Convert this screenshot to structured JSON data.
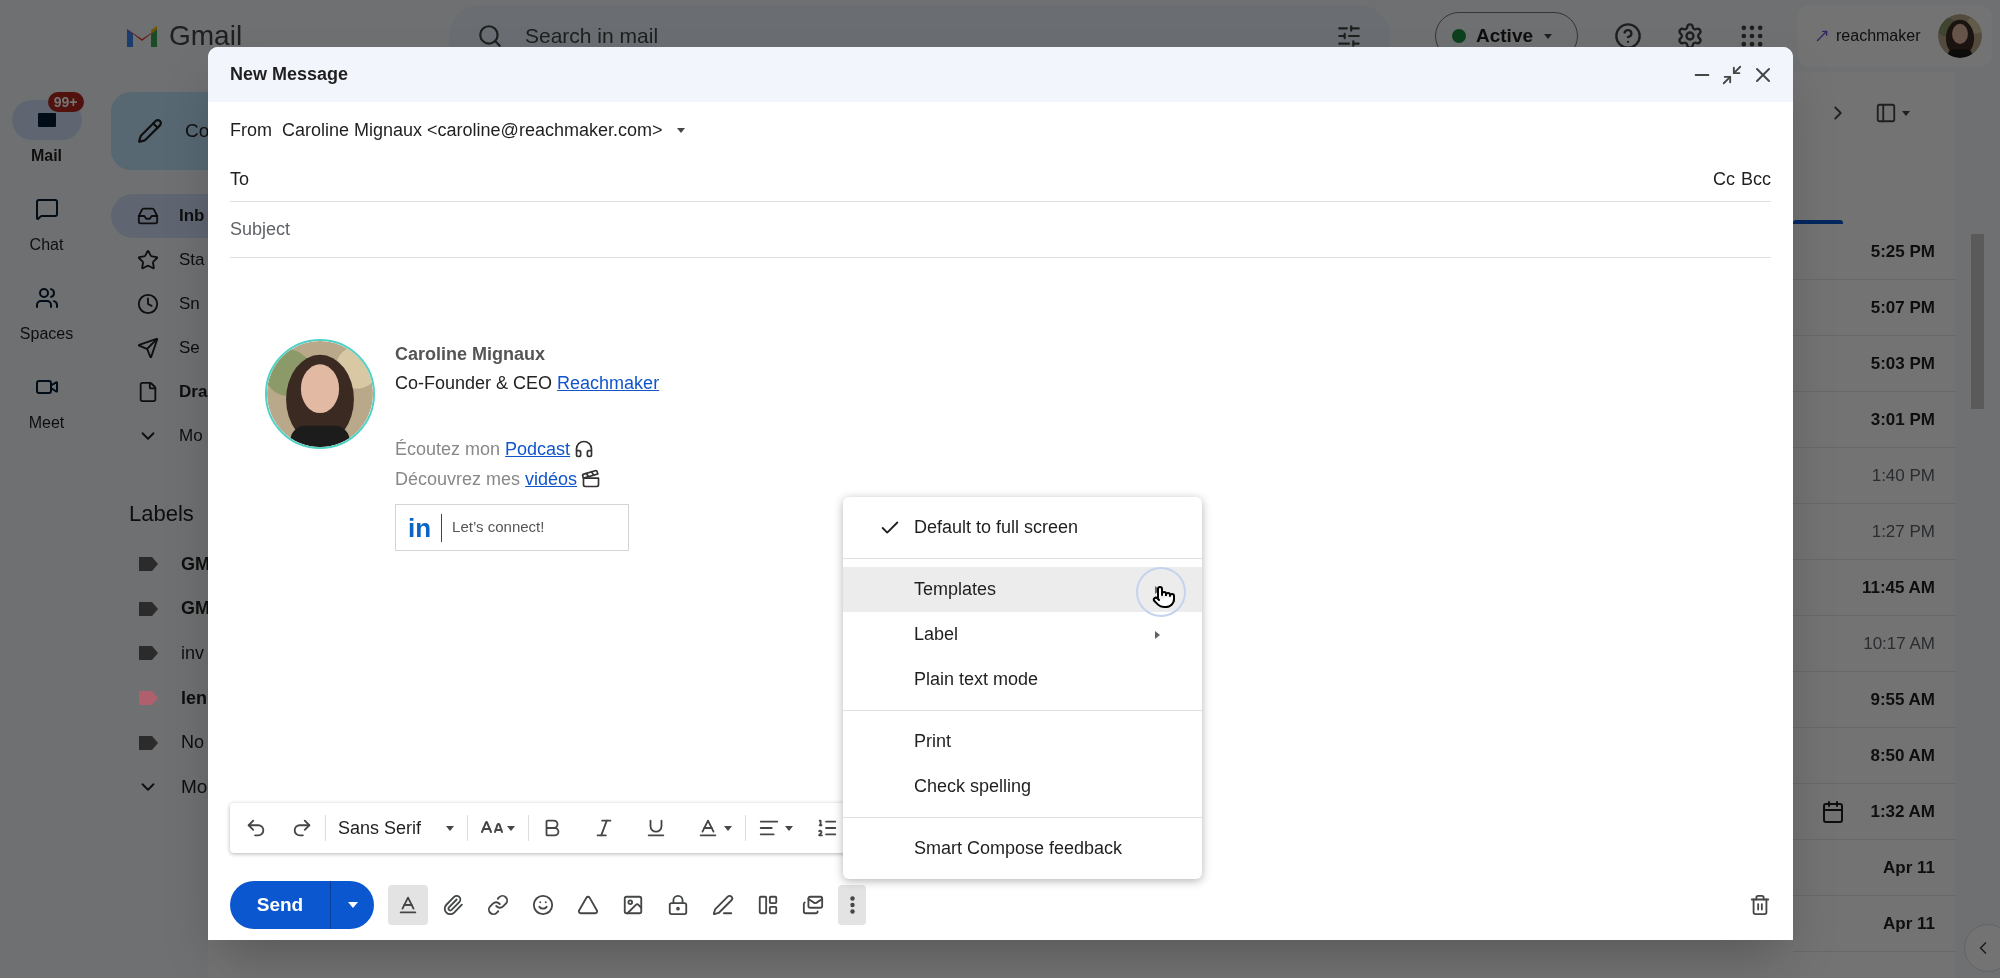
{
  "topbar": {
    "logo_text": "Gmail",
    "search": {
      "placeholder": "Search in mail"
    },
    "status": {
      "label": "Active"
    },
    "account": {
      "name": "reachmaker"
    }
  },
  "rail": [
    {
      "label": "Mail",
      "kind": "mail",
      "selected": true,
      "badge": "99+"
    },
    {
      "label": "Chat",
      "kind": "chat",
      "selected": false
    },
    {
      "label": "Spaces",
      "kind": "spaces",
      "selected": false
    },
    {
      "label": "Meet",
      "kind": "meet",
      "selected": false
    }
  ],
  "nav": {
    "compose": "Co",
    "items": [
      {
        "label": "Inb",
        "kind": "inbox",
        "selected": true,
        "has_unread": true
      },
      {
        "label": "Sta",
        "kind": "starred",
        "selected": false,
        "has_unread": false
      },
      {
        "label": "Sn",
        "kind": "snoozed",
        "selected": false,
        "has_unread": false
      },
      {
        "label": "Se",
        "kind": "sent",
        "selected": false,
        "has_unread": false
      },
      {
        "label": "Dra",
        "kind": "drafts",
        "selected": false,
        "has_unread": true
      },
      {
        "label": "Mo",
        "kind": "more",
        "selected": false,
        "has_unread": false
      }
    ],
    "labels_heading": "Labels",
    "labels": [
      {
        "label": "GM",
        "color": "#2b2b2b",
        "has_unread": true
      },
      {
        "label": "GM",
        "color": "#2b2b2b",
        "has_unread": true
      },
      {
        "label": "inv",
        "color": "#2b2b2b",
        "has_unread": false
      },
      {
        "label": "len",
        "color": "#b0606c",
        "has_unread": true
      },
      {
        "label": "No",
        "color": "#2b2b2b",
        "has_unread": false
      }
    ],
    "labels_more": "Mo"
  },
  "mail_list": [
    {
      "time": "5:25 PM",
      "unread": true,
      "calendar": false
    },
    {
      "time": "5:07 PM",
      "unread": true,
      "calendar": false
    },
    {
      "time": "5:03 PM",
      "unread": true,
      "calendar": false
    },
    {
      "time": "3:01 PM",
      "unread": true,
      "calendar": false
    },
    {
      "time": "1:40 PM",
      "unread": false,
      "calendar": false
    },
    {
      "time": "1:27 PM",
      "unread": false,
      "calendar": false
    },
    {
      "time": "11:45 AM",
      "unread": true,
      "calendar": false
    },
    {
      "time": "10:17 AM",
      "unread": false,
      "calendar": false
    },
    {
      "time": "9:55 AM",
      "unread": true,
      "calendar": false
    },
    {
      "time": "8:50 AM",
      "unread": true,
      "calendar": false
    },
    {
      "time": "1:32 AM",
      "unread": true,
      "calendar": true
    },
    {
      "time": "Apr 11",
      "unread": true,
      "calendar": false
    },
    {
      "time": "Apr 11",
      "unread": true,
      "calendar": false
    }
  ],
  "compose": {
    "title": "New Message",
    "from_label": "From",
    "from": "Caroline Mignaux <caroline@reachmaker.com>",
    "to_label": "To",
    "cc": "Cc",
    "bcc": "Bcc",
    "subject_placeholder": "Subject",
    "signature": {
      "name": "Caroline Mignaux",
      "role": "Co-Founder & CEO",
      "company_link": "Reachmaker",
      "podcast_text": "Écoutez mon",
      "podcast_link": "Podcast",
      "videos_text": "Découvrez mes",
      "videos_link": "vidéos",
      "linkedin_logo": "in",
      "linkedin_label": "Let’s connect!"
    },
    "font": "Sans Serif",
    "send": "Send",
    "formatting_on": true,
    "more_active": true
  },
  "menu": {
    "sections": [
      [
        {
          "label": "Default to full screen",
          "checked": true,
          "submenu": false,
          "highlighted": false
        }
      ],
      [
        {
          "label": "Templates",
          "checked": false,
          "submenu": true,
          "highlighted": true
        },
        {
          "label": "Label",
          "checked": false,
          "submenu": true,
          "highlighted": false
        },
        {
          "label": "Plain text mode",
          "checked": false,
          "submenu": false,
          "highlighted": false
        }
      ],
      [
        {
          "label": "Print",
          "checked": false,
          "submenu": false,
          "highlighted": false
        },
        {
          "label": "Check spelling",
          "checked": false,
          "submenu": false,
          "highlighted": false
        }
      ],
      [
        {
          "label": "Smart Compose feedback",
          "checked": false,
          "submenu": false,
          "highlighted": false
        }
      ]
    ]
  }
}
